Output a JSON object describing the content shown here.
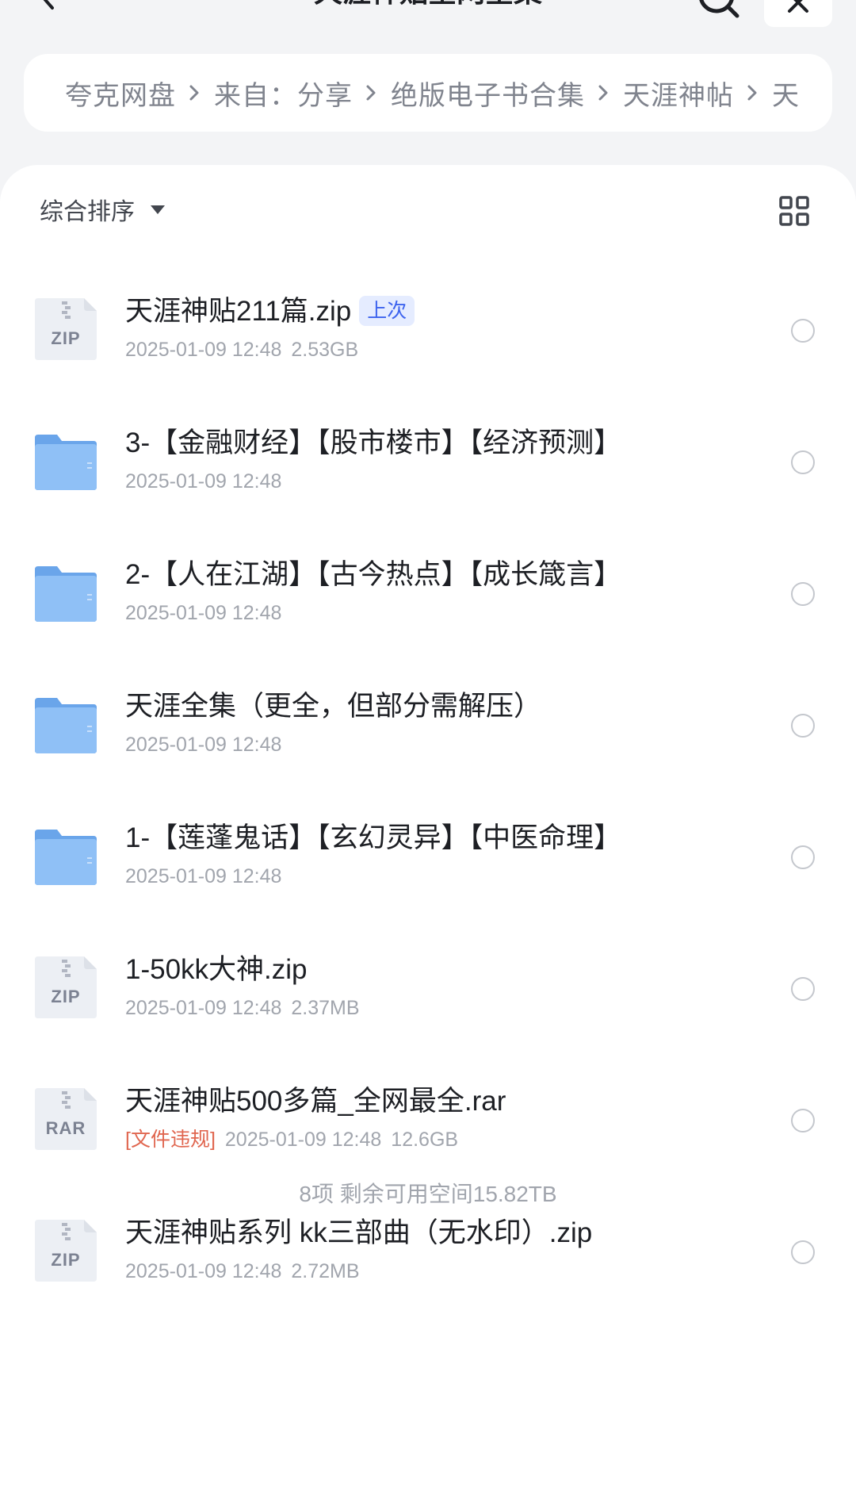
{
  "header": {
    "title": "天涯神贴全网全集"
  },
  "breadcrumb": [
    "夸克网盘",
    "来自：分享",
    "绝版电子书合集",
    "天涯神帖",
    "天"
  ],
  "toolbar": {
    "sort_label": "综合排序"
  },
  "files": [
    {
      "type": "zip",
      "icon_label": "ZIP",
      "name": "天涯神贴211篇.zip",
      "badge": "上次",
      "warning": "",
      "date": "2025-01-09 12:48",
      "size": "2.53GB"
    },
    {
      "type": "folder",
      "icon_label": "",
      "name": "3-【金融财经】【股市楼市】【经济预测】",
      "badge": "",
      "warning": "",
      "date": "2025-01-09 12:48",
      "size": ""
    },
    {
      "type": "folder",
      "icon_label": "",
      "name": "2-【人在江湖】【古今热点】【成长箴言】",
      "badge": "",
      "warning": "",
      "date": "2025-01-09 12:48",
      "size": ""
    },
    {
      "type": "folder",
      "icon_label": "",
      "name": "天涯全集（更全，但部分需解压）",
      "badge": "",
      "warning": "",
      "date": "2025-01-09 12:48",
      "size": ""
    },
    {
      "type": "folder",
      "icon_label": "",
      "name": "1-【莲蓬鬼话】【玄幻灵异】【中医命理】",
      "badge": "",
      "warning": "",
      "date": "2025-01-09 12:48",
      "size": ""
    },
    {
      "type": "zip",
      "icon_label": "ZIP",
      "name": "1-50kk大神.zip",
      "badge": "",
      "warning": "",
      "date": "2025-01-09 12:48",
      "size": "2.37MB"
    },
    {
      "type": "rar",
      "icon_label": "RAR",
      "name": "天涯神贴500多篇_全网最全.rar",
      "badge": "",
      "warning": "[文件违规]",
      "date": "2025-01-09 12:48",
      "size": "12.6GB"
    },
    {
      "type": "zip",
      "icon_label": "ZIP",
      "name": "天涯神贴系列 kk三部曲（无水印）.zip",
      "badge": "",
      "warning": "",
      "date": "2025-01-09 12:48",
      "size": "2.72MB"
    }
  ],
  "footer": {
    "summary": "8项 剩余可用空间15.82TB"
  },
  "colors": {
    "folder": "#7fb4f2",
    "archive_bg": "#eef0f4",
    "badge_text": "#3d63ee",
    "warning": "#e0664f"
  }
}
